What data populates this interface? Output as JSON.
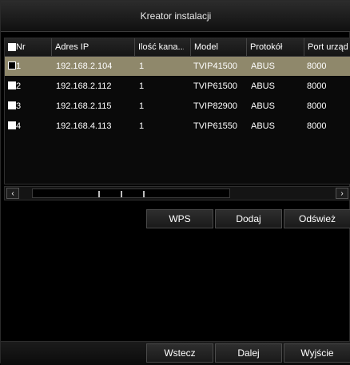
{
  "window": {
    "title": "Kreator instalacji"
  },
  "table": {
    "columns": {
      "nr": "Nr",
      "ip": "Adres IP",
      "channels": "Ilość kana...",
      "model": "Model",
      "protocol": "Protokół",
      "port": "Port urząd"
    },
    "rows": [
      {
        "nr": "1",
        "ip": "192.168.2.104",
        "channels": "1",
        "model": "TVIP41500",
        "protocol": "ABUS",
        "port": "8000",
        "selected": true,
        "checked": false
      },
      {
        "nr": "2",
        "ip": "192.168.2.112",
        "channels": "1",
        "model": "TVIP61500",
        "protocol": "ABUS",
        "port": "8000",
        "selected": false,
        "checked": true
      },
      {
        "nr": "3",
        "ip": "192.168.2.115",
        "channels": "1",
        "model": "TVIP82900",
        "protocol": "ABUS",
        "port": "8000",
        "selected": false,
        "checked": true
      },
      {
        "nr": "4",
        "ip": "192.168.4.113",
        "channels": "1",
        "model": "TVIP61550",
        "protocol": "ABUS",
        "port": "8000",
        "selected": false,
        "checked": true
      }
    ]
  },
  "scrollbar": {
    "left_icon": "chevron-left-icon",
    "right_icon": "chevron-right-icon",
    "left_glyph": "‹",
    "right_glyph": "›"
  },
  "actions": {
    "wps": "WPS",
    "add": "Dodaj",
    "refresh": "Odśwież"
  },
  "footer": {
    "back": "Wstecz",
    "next": "Dalej",
    "exit": "Wyjście"
  },
  "colors": {
    "selected_row": "#8f886b",
    "background": "#000000"
  }
}
